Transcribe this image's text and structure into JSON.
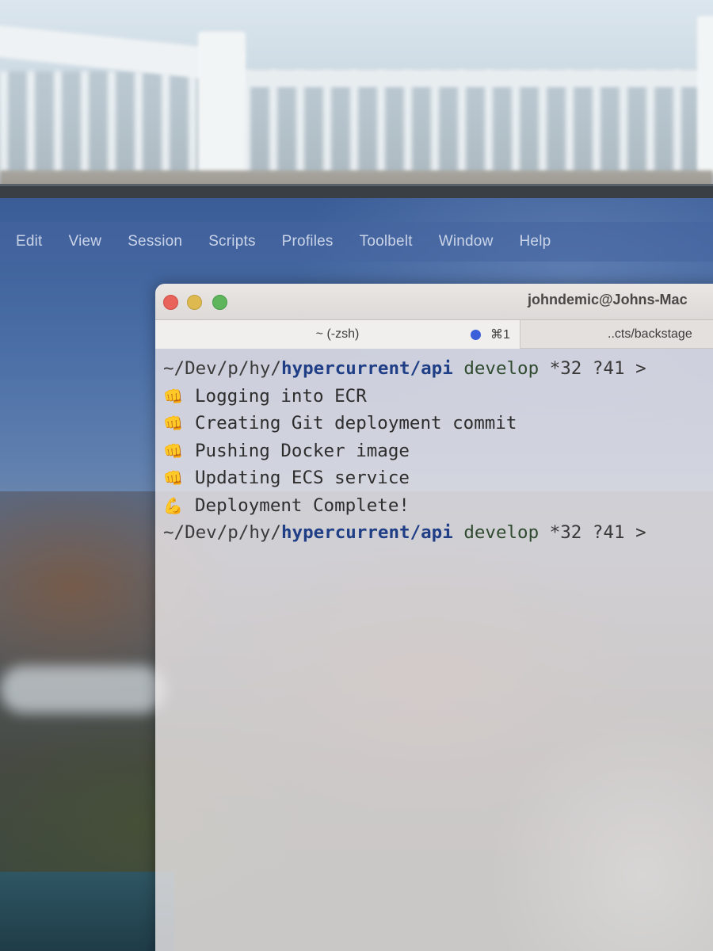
{
  "menubar": {
    "items": [
      "Edit",
      "View",
      "Session",
      "Scripts",
      "Profiles",
      "Toolbelt",
      "Window",
      "Help"
    ]
  },
  "window": {
    "title": "johndemic@Johns-Mac"
  },
  "tabs": [
    {
      "label": "~ (-zsh)",
      "shortcut": "⌘1",
      "active": true,
      "indicator_color": "#3a5fd8"
    },
    {
      "label": "..cts/backstage",
      "active": false
    }
  ],
  "terminal": {
    "prompt": {
      "path_prefix": "~/Dev/p/hy/",
      "path_highlight": "hypercurrent",
      "path_suffix": "/api",
      "branch": "develop",
      "modified": "*32",
      "untracked": "?41",
      "symbol": ">"
    },
    "output": [
      {
        "icon": "👊",
        "icon_name": "fist-icon",
        "text": "Logging into ECR"
      },
      {
        "icon": "👊",
        "icon_name": "fist-icon",
        "text": "Creating Git deployment commit"
      },
      {
        "icon": "👊",
        "icon_name": "fist-icon",
        "text": "Pushing Docker image"
      },
      {
        "icon": "👊",
        "icon_name": "fist-icon",
        "text": "Updating ECS service"
      },
      {
        "icon": "💪",
        "icon_name": "flexed-biceps-icon",
        "text": "Deployment Complete!"
      }
    ]
  },
  "colors": {
    "path_highlight": "#1f3e86",
    "traffic_close": "#e8635a",
    "traffic_minimize": "#ddb94f",
    "traffic_maximize": "#5eb55b"
  }
}
